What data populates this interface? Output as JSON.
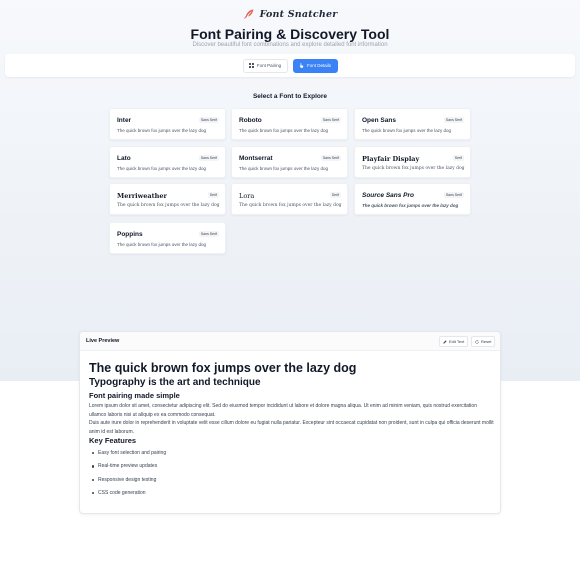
{
  "header": {
    "brand_name": "Font Snatcher",
    "title": "Font Pairing & Discovery Tool",
    "subtitle": "Discover beautiful font combinations and explore detailed font information"
  },
  "tabs": [
    {
      "label": "Font Pairing",
      "icon": "grid-icon",
      "active": false
    },
    {
      "label": "Font Details",
      "icon": "hand-pointer-icon",
      "active": true
    }
  ],
  "colors": {
    "accent": "#3b82f6",
    "brand_icon": "#e45c4f"
  },
  "explore": {
    "heading": "Select a Font to Explore",
    "sample": "The quick brown fox jumps over the lazy dog",
    "fonts": [
      {
        "name": "Inter",
        "category": "Sans Serif"
      },
      {
        "name": "Roboto",
        "category": "Sans Serif"
      },
      {
        "name": "Open Sans",
        "category": "Sans Serif"
      },
      {
        "name": "Lato",
        "category": "Sans Serif"
      },
      {
        "name": "Montserrat",
        "category": "Sans Serif"
      },
      {
        "name": "Playfair Display",
        "category": "Serif"
      },
      {
        "name": "Merriweather",
        "category": "Serif"
      },
      {
        "name": "Lora",
        "category": "Serif"
      },
      {
        "name": "Source Sans Pro",
        "category": "Sans Serif"
      },
      {
        "name": "Poppins",
        "category": "Sans Serif"
      }
    ]
  },
  "preview": {
    "title": "Live Preview",
    "edit_label": "Edit Text",
    "reset_label": "Reset",
    "heading1": "The quick brown fox jumps over the lazy dog",
    "heading2": "Typography is the art and technique",
    "heading3": "Font pairing made simple",
    "paragraph1": "Lorem ipsum dolor sit amet, consectetur adipiscing elit. Sed do eiusmod tempor incididunt ut labore et dolore magna aliqua. Ut enim ad minim veniam, quis nostrud exercitation ullamco laboris nisi ut aliquip ex ea commodo consequat.",
    "paragraph2": "Duis aute irure dolor in reprehenderit in voluptate velit esse cillum dolore eu fugiat nulla pariatur. Excepteur sint occaecat cupidatat non proident, sunt in culpa qui officia deserunt mollit anim id est laborum.",
    "features_heading": "Key Features",
    "features": [
      "Easy font selection and pairing",
      "Real-time preview updates",
      "Responsive design testing",
      "CSS code generation"
    ]
  }
}
